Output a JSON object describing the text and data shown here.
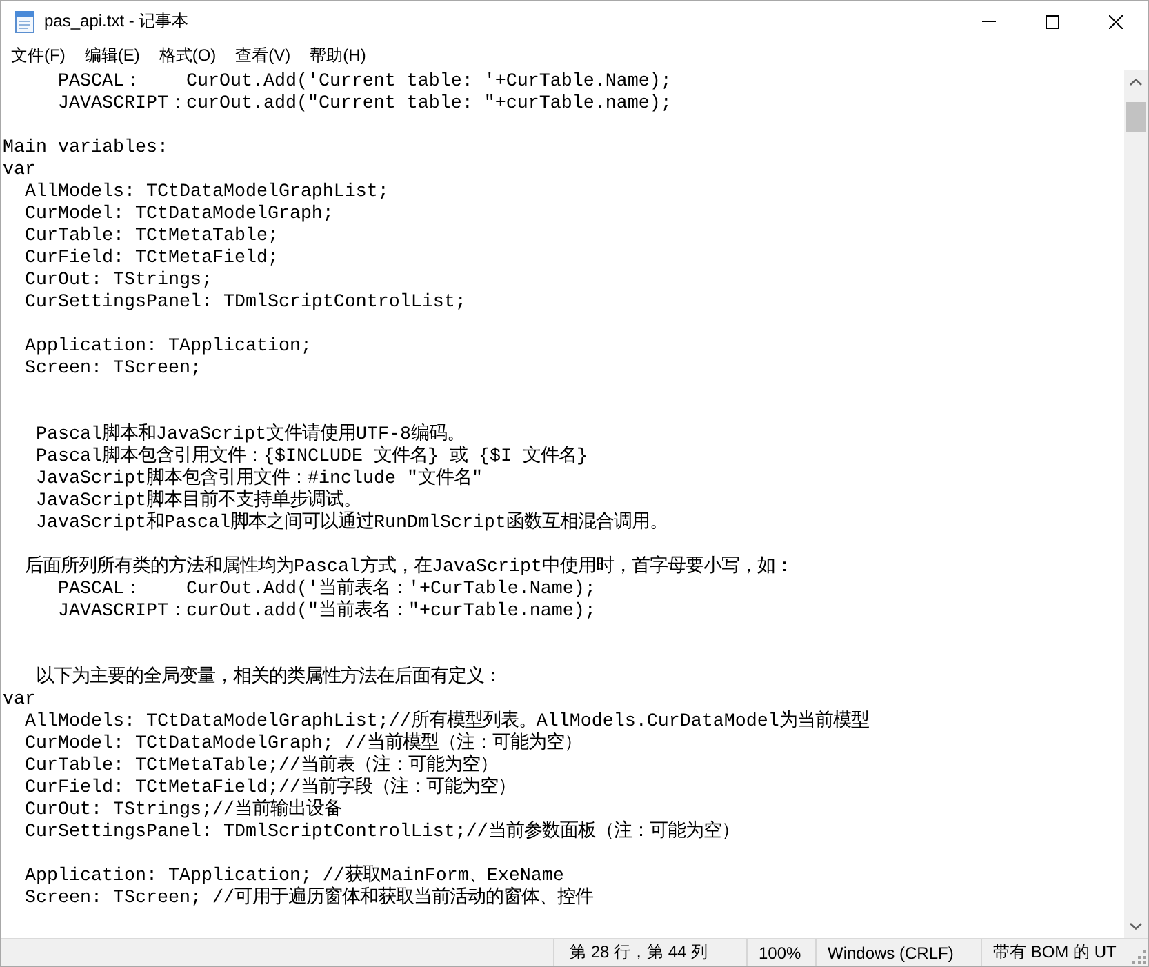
{
  "window": {
    "title": "pas_api.txt - 记事本"
  },
  "menu": [
    "文件(F)",
    "编辑(E)",
    "格式(O)",
    "查看(V)",
    "帮助(H)"
  ],
  "editor": {
    "lines": [
      {
        "kind": "text",
        "text": "     PASCAL：    CurOut.Add('Current table: '+CurTable.Name);"
      },
      {
        "kind": "text",
        "text": "     JAVASCRIPT：curOut.add(\"Current table: \"+curTable.name);"
      },
      {
        "kind": "blank"
      },
      {
        "kind": "text",
        "text": "Main variables:"
      },
      {
        "kind": "text",
        "text": "var"
      },
      {
        "kind": "text",
        "text": "  AllModels: TCtDataModelGraphList;"
      },
      {
        "kind": "text",
        "text": "  CurModel: TCtDataModelGraph;"
      },
      {
        "kind": "text",
        "text": "  CurTable: TCtMetaTable;"
      },
      {
        "kind": "text",
        "text": "  CurField: TCtMetaField;"
      },
      {
        "kind": "text",
        "text": "  CurOut: TStrings;"
      },
      {
        "kind": "text",
        "text": "  CurSettingsPanel: TDmlScriptControlList;"
      },
      {
        "kind": "blank"
      },
      {
        "kind": "text",
        "text": "  Application: TApplication;"
      },
      {
        "kind": "text",
        "text": "  Screen: TScreen;"
      },
      {
        "kind": "blank"
      },
      {
        "kind": "blank"
      },
      {
        "kind": "text",
        "text": "   Pascal脚本和JavaScript文件请使用UTF-8编码。"
      },
      {
        "kind": "text",
        "text": "   Pascal脚本包含引用文件：{$INCLUDE 文件名} 或 {$I 文件名}"
      },
      {
        "kind": "text",
        "text": "   JavaScript脚本包含引用文件：#include \"文件名\""
      },
      {
        "kind": "text",
        "text": "   JavaScript脚本目前不支持单步调试。"
      },
      {
        "kind": "text",
        "text": "   JavaScript和Pascal脚本之间可以通过RunDmlScript函数互相混合调用。"
      },
      {
        "kind": "blank"
      },
      {
        "kind": "text",
        "text": "  后面所列所有类的方法和属性均为Pascal方式，在JavaScript中使用时，首字母要小写，如："
      },
      {
        "kind": "text",
        "text": "     PASCAL：    CurOut.Add('当前表名：'+CurTable.Name);"
      },
      {
        "kind": "text",
        "text": "     JAVASCRIPT：curOut.add(\"当前表名：\"+curTable.name);"
      },
      {
        "kind": "blank"
      },
      {
        "kind": "blank"
      },
      {
        "kind": "text",
        "text": "   以下为主要的全局变量，相关的类属性方法在后面有定义："
      },
      {
        "kind": "text",
        "text": "var"
      },
      {
        "kind": "text",
        "text": "  AllModels: TCtDataModelGraphList;//所有模型列表。AllModels.CurDataModel为当前模型"
      },
      {
        "kind": "text",
        "text": "  CurModel: TCtDataModelGraph; //当前模型（注：可能为空）"
      },
      {
        "kind": "text",
        "text": "  CurTable: TCtMetaTable;//当前表（注：可能为空）"
      },
      {
        "kind": "text",
        "text": "  CurField: TCtMetaField;//当前字段（注：可能为空）"
      },
      {
        "kind": "text",
        "text": "  CurOut: TStrings;//当前输出设备"
      },
      {
        "kind": "text",
        "text": "  CurSettingsPanel: TDmlScriptControlList;//当前参数面板（注：可能为空）"
      },
      {
        "kind": "blank"
      },
      {
        "kind": "text",
        "text": "  Application: TApplication; //获取MainForm、ExeName"
      },
      {
        "kind": "text",
        "text": "  Screen: TScreen; //可用于遍历窗体和获取当前活动的窗体、控件"
      }
    ]
  },
  "status_bar": {
    "segments": [
      {
        "kind": "position",
        "text": "第 28 行，第 44 列"
      },
      {
        "kind": "zoom",
        "text": "100%"
      },
      {
        "kind": "line_ending",
        "text": "Windows (CRLF)"
      },
      {
        "kind": "encoding",
        "text": "带有 BOM 的 UT"
      }
    ]
  }
}
